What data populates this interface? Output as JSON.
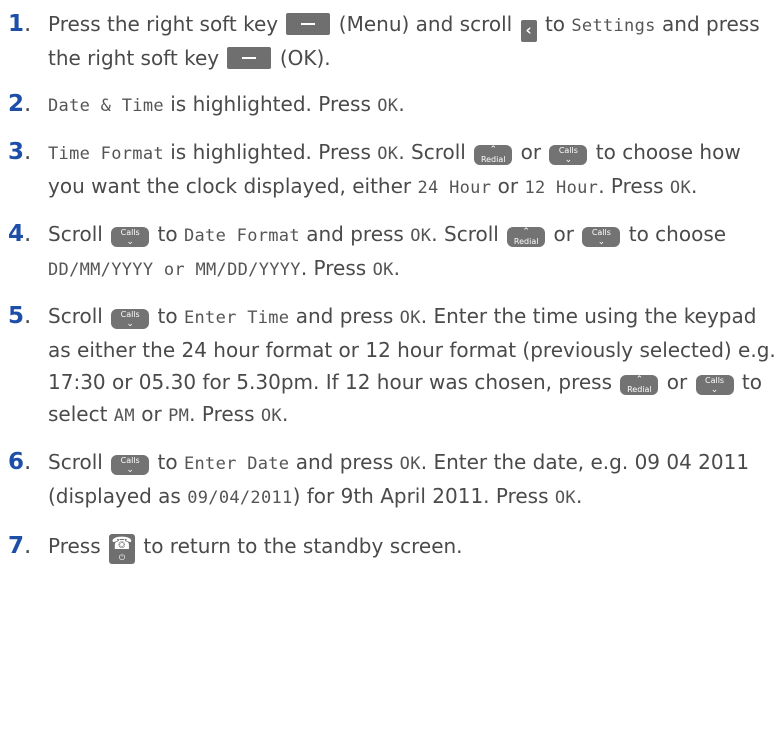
{
  "steps": [
    {
      "number": "1",
      "parts": [
        "Press the right soft key",
        "(Menu) and scroll",
        "to",
        "Settings",
        "and press the right soft key",
        "(OK)."
      ]
    },
    {
      "number": "2",
      "parts": [
        "Date & Time",
        "is highlighted. Press",
        "OK",
        "."
      ]
    },
    {
      "number": "3",
      "parts": [
        "Time Format",
        "is highlighted. Press",
        "OK",
        ". Scroll",
        "or",
        "to choose how you want the clock displayed, either",
        "24 Hour",
        "or",
        "12 Hour",
        ". Press",
        "OK",
        "."
      ]
    },
    {
      "number": "4",
      "parts": [
        "Scroll",
        "to",
        "Date Format",
        "and press",
        "OK",
        ". Scroll",
        "or",
        "to choose",
        "DD/MM/YYYY or MM/DD/YYYY",
        ". Press",
        "OK",
        "."
      ]
    },
    {
      "number": "5",
      "parts": [
        "Scroll",
        "to",
        "Enter Time",
        "and press",
        "OK",
        ". Enter the time using the keypad as either the 24 hour format or 12 hour format (previously selected) e.g. 17:30 or 05.30 for 5.30pm. If 12 hour was chosen, press",
        "or",
        "to select",
        "AM",
        "or",
        "PM",
        ". Press",
        "OK",
        "."
      ]
    },
    {
      "number": "6",
      "parts": [
        "Scroll",
        "to",
        "Enter Date",
        "and press",
        "OK",
        ". Enter the date, e.g. 09 04 2011 (displayed as",
        "09/04/2011",
        ") for 9th April 2011. Press",
        "OK",
        "."
      ]
    },
    {
      "number": "7",
      "parts": [
        "Press",
        "to return to the standby screen."
      ]
    }
  ],
  "key_labels": {
    "redial": "Redial",
    "calls": "Calls",
    "up_arrow": "⌃",
    "down_arrow": "⌄",
    "left_chevron": "‹",
    "soft_key_dash": "",
    "power": "⏻",
    "handset": "☎"
  },
  "colors": {
    "step_number": "#1e4fa8",
    "key_fill": "#6f6f6f",
    "text": "#4a4a4a"
  }
}
